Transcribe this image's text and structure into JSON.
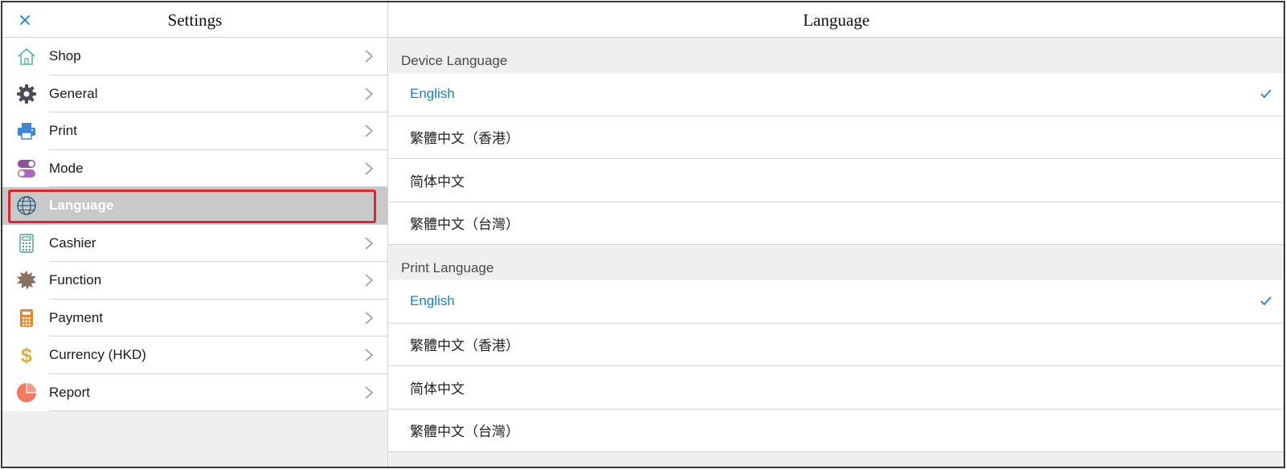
{
  "sidebar": {
    "title": "Settings",
    "items": [
      {
        "label": "Shop",
        "icon": "home-icon",
        "active": false
      },
      {
        "label": "General",
        "icon": "gear-icon",
        "active": false
      },
      {
        "label": "Print",
        "icon": "printer-icon",
        "active": false
      },
      {
        "label": "Mode",
        "icon": "toggle-icon",
        "active": false
      },
      {
        "label": "Language",
        "icon": "globe-icon",
        "active": true
      },
      {
        "label": "Cashier",
        "icon": "cash-register-icon",
        "active": false
      },
      {
        "label": "Function",
        "icon": "cog-badge-icon",
        "active": false
      },
      {
        "label": "Payment",
        "icon": "calculator-icon",
        "active": false
      },
      {
        "label": "Currency (HKD)",
        "icon": "dollar-icon",
        "active": false
      },
      {
        "label": "Report",
        "icon": "pie-chart-icon",
        "active": false
      }
    ]
  },
  "main": {
    "title": "Language",
    "sections": [
      {
        "header": "Device Language",
        "options": [
          {
            "label": "English",
            "selected": true
          },
          {
            "label": "繁體中文（香港）",
            "selected": false
          },
          {
            "label": "简体中文",
            "selected": false
          },
          {
            "label": "繁體中文（台灣）",
            "selected": false
          }
        ]
      },
      {
        "header": "Print Language",
        "options": [
          {
            "label": "English",
            "selected": true
          },
          {
            "label": "繁體中文（香港）",
            "selected": false
          },
          {
            "label": "简体中文",
            "selected": false
          },
          {
            "label": "繁體中文（台灣）",
            "selected": false
          }
        ]
      }
    ]
  },
  "colors": {
    "accent": "#1a7fd4",
    "highlight_outline": "#e0262a",
    "active_row": "#c8c8c8"
  }
}
